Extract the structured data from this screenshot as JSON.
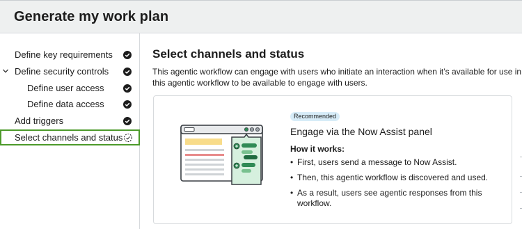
{
  "header": {
    "title": "Generate my work plan"
  },
  "sidebar": {
    "items": [
      {
        "label": "Define key requirements",
        "status": "complete"
      },
      {
        "label": "Define security controls",
        "status": "complete",
        "expanded": true
      },
      {
        "label": "Define user access",
        "status": "complete"
      },
      {
        "label": "Define data access",
        "status": "complete"
      },
      {
        "label": "Add triggers",
        "status": "complete"
      },
      {
        "label": "Select channels and status",
        "status": "in-progress",
        "active": true
      }
    ]
  },
  "main": {
    "title": "Select channels and status",
    "description_line1": "This agentic workflow can engage with users who initiate an interaction when it’s available for use in c",
    "description_line2": "this agentic workflow to be available to engage with users.",
    "card": {
      "badge": "Recommended",
      "title": "Engage via the Now Assist panel",
      "how_label": "How it works:",
      "bullets": [
        "First, users send a message to Now Assist.",
        "Then, this agentic workflow is discovered and used.",
        "As a result, users see agentic responses from this workflow."
      ]
    }
  },
  "colors": {
    "header_bg": "#eef0f0",
    "active_border": "#4c9a2a",
    "badge_bg": "#d7ecf8",
    "illustration_accent": "#2f8a55",
    "illustration_highlight": "#f8dc8a"
  },
  "icons": {
    "complete": "check-circle-icon",
    "in_progress": "progress-circle-icon",
    "expand": "chevron-down-icon"
  }
}
